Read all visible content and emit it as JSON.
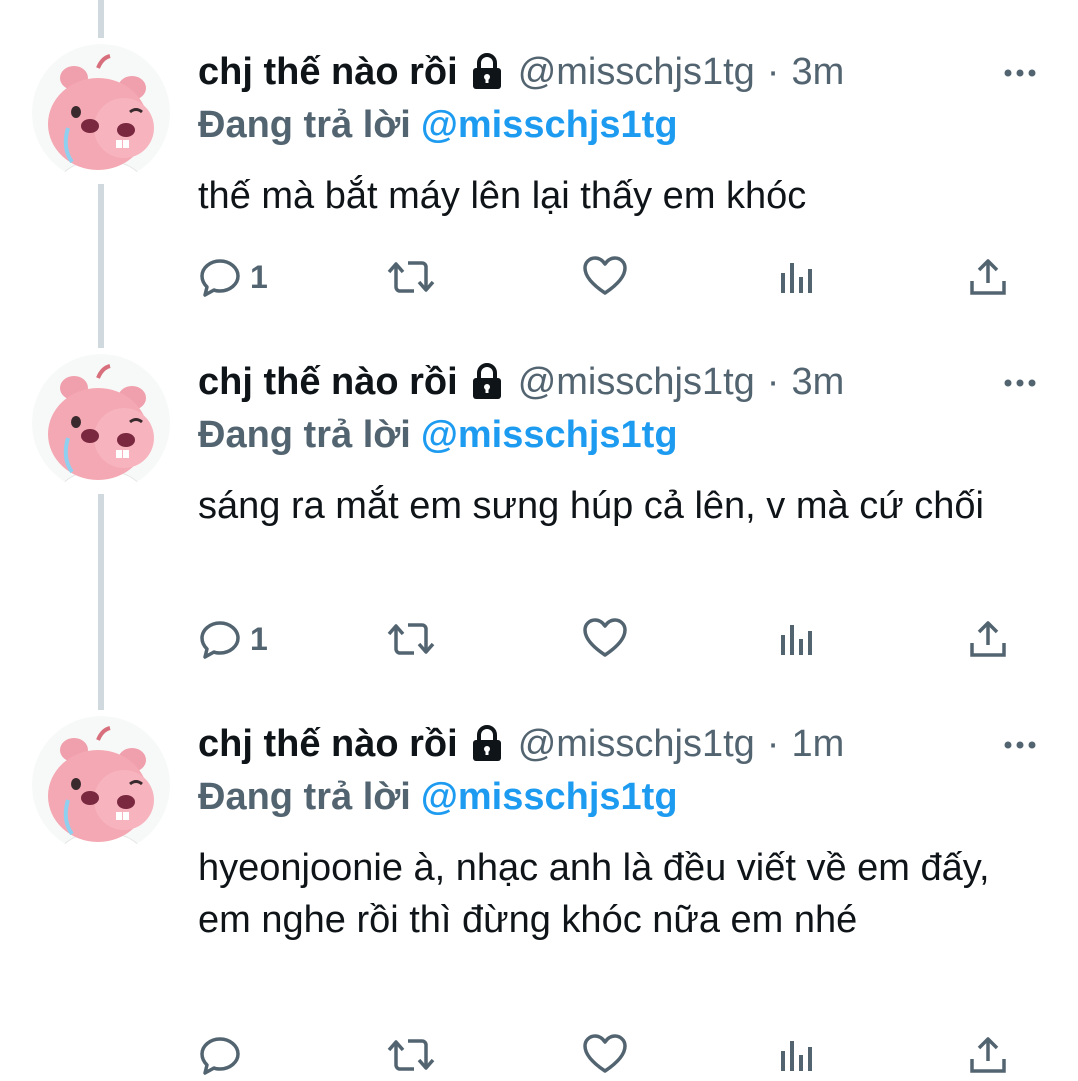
{
  "tweets": [
    {
      "name": "chj thế nào rồi",
      "handle": "@misschjs1tg",
      "separator": "·",
      "time": "3m",
      "reply_prefix": "Đang trả lời",
      "reply_to": "@misschjs1tg",
      "text": "thế mà bắt máy lên lại thấy em khóc",
      "reply_count": "1"
    },
    {
      "name": "chj thế nào rồi",
      "handle": "@misschjs1tg",
      "separator": "·",
      "time": "3m",
      "reply_prefix": "Đang trả lời",
      "reply_to": "@misschjs1tg",
      "text": "sáng ra mắt em sưng húp cả lên, v mà cứ chối",
      "reply_count": "1"
    },
    {
      "name": "chj thế nào rồi",
      "handle": "@misschjs1tg",
      "separator": "·",
      "time": "1m",
      "reply_prefix": "Đang trả lời",
      "reply_to": "@misschjs1tg",
      "text": "hyeonjoonie à, nhạc anh là đều viết về em đấy, em nghe rồi thì đừng khóc nữa em nhé",
      "reply_count": ""
    }
  ],
  "icons": {
    "lock": "lock-icon",
    "more": "more-icon",
    "reply": "reply-icon",
    "retweet": "retweet-icon",
    "like": "heart-icon",
    "views": "views-icon",
    "share": "share-icon"
  },
  "colors": {
    "link": "#1d9bf0",
    "secondary": "#536471",
    "text": "#0f1419",
    "thread_line": "#cfd9de",
    "avatar_pink": "#f0a0ac"
  }
}
